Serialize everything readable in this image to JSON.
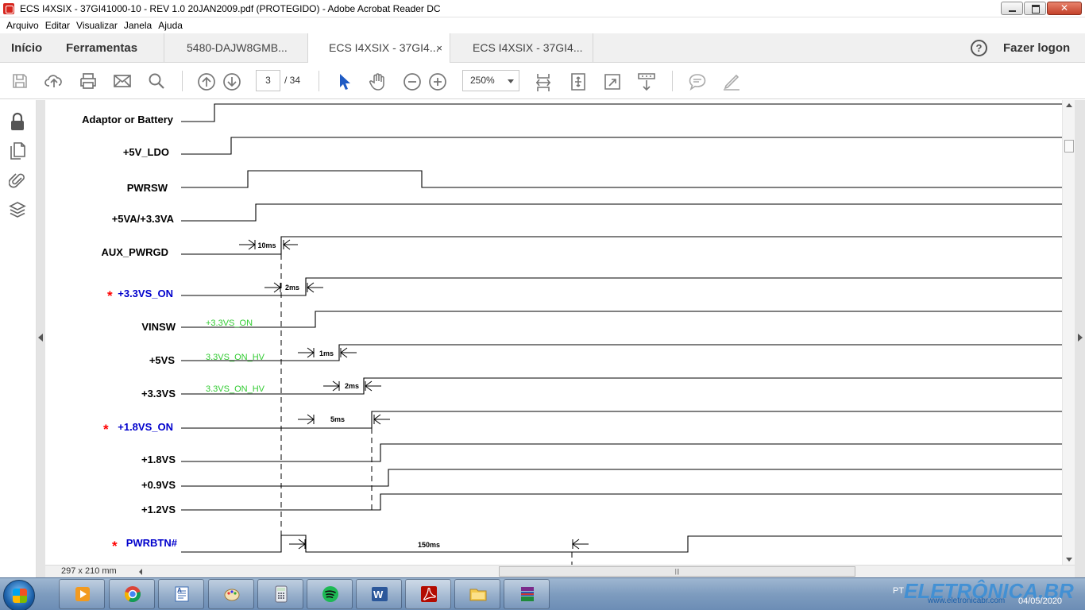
{
  "window": {
    "title": "ECS I4XSIX - 37GI41000-10 - REV 1.0 20JAN2009.pdf (PROTEGIDO) - Adobe Acrobat Reader DC"
  },
  "menu": [
    "Arquivo",
    "Editar",
    "Visualizar",
    "Janela",
    "Ajuda"
  ],
  "nav": {
    "home": "Início",
    "tools": "Ferramentas",
    "login": "Fazer logon",
    "help_icon": "help-icon"
  },
  "tabs": [
    {
      "label": "5480-DAJW8GMB...",
      "active": false
    },
    {
      "label": "ECS I4XSIX - 37GI4...",
      "active": true,
      "close": "×"
    },
    {
      "label": "ECS I4XSIX - 37GI4...",
      "active": false
    }
  ],
  "toolbar": {
    "page_current": "3",
    "page_total": "/ 34",
    "zoom": "250%",
    "icons": [
      "save-icon",
      "upload-icon",
      "print-icon",
      "email-icon",
      "search-icon",
      "page-up-icon",
      "page-down-icon",
      "select-icon",
      "hand-icon",
      "zoom-out-icon",
      "zoom-in-icon",
      "fit-page-icon",
      "full-screen-icon",
      "expand-icon",
      "scroll-mode-icon",
      "comment-icon",
      "sign-icon"
    ]
  },
  "rail_icons": [
    "lock-icon",
    "pages-icon",
    "attachment-icon",
    "layers-icon"
  ],
  "status": {
    "page_size": "297 x 210 mm"
  },
  "timing": {
    "signals": [
      {
        "label": "Adaptor or Battery",
        "color": "#000000",
        "star": false
      },
      {
        "label": "+5V_LDO",
        "color": "#000000",
        "star": false
      },
      {
        "label": "PWRSW",
        "color": "#000000",
        "star": false
      },
      {
        "label": "+5VA/+3.3VA",
        "color": "#000000",
        "star": false
      },
      {
        "label": "AUX_PWRGD",
        "color": "#000000",
        "star": false
      },
      {
        "label": "+3.3VS_ON",
        "color": "#0000cc",
        "star": true
      },
      {
        "label": "VINSW",
        "color": "#000000",
        "star": false
      },
      {
        "label": "+5VS",
        "color": "#000000",
        "star": false
      },
      {
        "label": "+3.3VS",
        "color": "#000000",
        "star": false
      },
      {
        "label": "+1.8VS_ON",
        "color": "#0000cc",
        "star": true
      },
      {
        "label": "+1.8VS",
        "color": "#000000",
        "star": false
      },
      {
        "label": "+0.9VS",
        "color": "#000000",
        "star": false
      },
      {
        "label": "+1.2VS",
        "color": "#000000",
        "star": false
      },
      {
        "label": "PWRBTN#",
        "color": "#0000cc",
        "star": true
      }
    ],
    "triggers": [
      "+3.3VS_ON",
      "3.3VS_ON_HV",
      "3.3VS_ON_HV"
    ],
    "delays": [
      "10ms",
      "2ms",
      "1ms",
      "2ms",
      "5ms",
      "150ms"
    ],
    "star_glyph": "*",
    "trigger_color": "#33cc33"
  },
  "taskbar": {
    "apps": [
      "media-player-icon",
      "chrome-icon",
      "wordpad-icon",
      "paint-icon",
      "calculator-icon",
      "spotify-icon",
      "word-icon",
      "acrobat-icon",
      "explorer-icon",
      "winrar-icon"
    ],
    "tray_lang": "PT",
    "watermark": "ELETRÔNICA.BR",
    "watermark_sub": "www.eletronicabr.com",
    "clock": "04/05/2020"
  }
}
